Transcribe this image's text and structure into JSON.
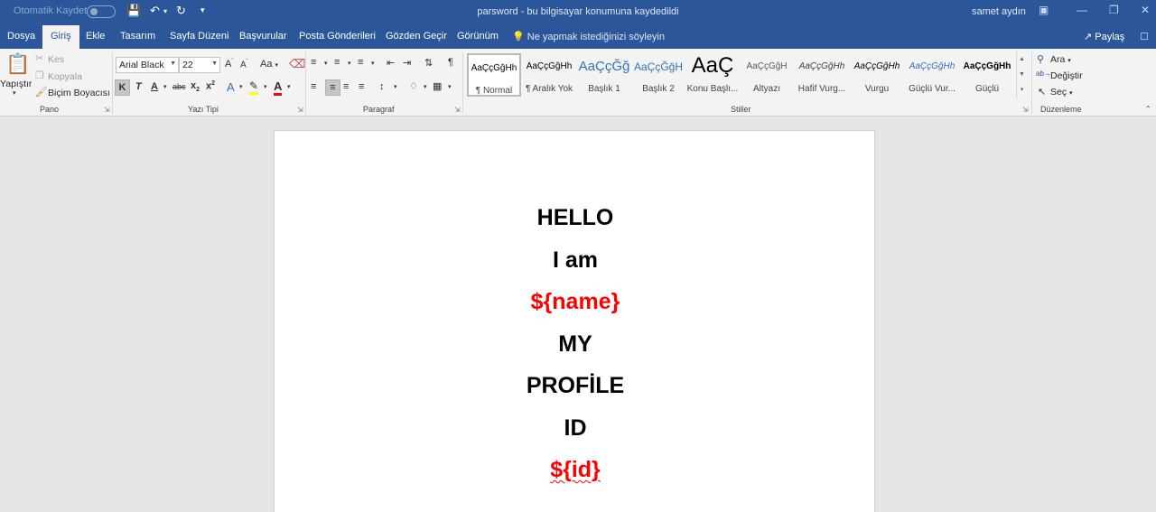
{
  "titlebar": {
    "autosave_label": "Otomatik Kaydet",
    "document_title": "parsword  -  bu bilgisayar konumuna kaydedildi",
    "user_name": "samet aydın"
  },
  "tabs": [
    {
      "label": "Dosya"
    },
    {
      "label": "Giriş"
    },
    {
      "label": "Ekle"
    },
    {
      "label": "Tasarım"
    },
    {
      "label": "Sayfa Düzeni"
    },
    {
      "label": "Başvurular"
    },
    {
      "label": "Posta Gönderileri"
    },
    {
      "label": "Gözden Geçir"
    },
    {
      "label": "Görünüm"
    }
  ],
  "tell_me": "Ne yapmak istediğinizi söyleyin",
  "share_label": "Paylaş",
  "clipboard": {
    "paste": "Yapıştır",
    "cut": "Kes",
    "copy": "Kopyala",
    "format_painter": "Biçim Boyacısı",
    "group": "Pano"
  },
  "font": {
    "family": "Arial Black",
    "size": "22",
    "grow": "A",
    "shrink": "A",
    "change_case": "Aa",
    "bold": "K",
    "italic": "T",
    "underline": "A",
    "strike": "abc",
    "subscript": "x",
    "superscript": "x",
    "text_effects": "A",
    "font_color": "A",
    "group": "Yazı Tipi"
  },
  "paragraph": {
    "group": "Paragraf"
  },
  "styles": {
    "group": "Stiller",
    "items": [
      {
        "sample": "AaÇçĞğHh",
        "name": "¶ Normal"
      },
      {
        "sample": "AaÇçĞğHh",
        "name": "¶ Aralık Yok"
      },
      {
        "sample": "AaÇçĞğ",
        "name": "Başlık 1"
      },
      {
        "sample": "AaÇçĞğH",
        "name": "Başlık 2"
      },
      {
        "sample": "AaÇ",
        "name": "Konu Başlı..."
      },
      {
        "sample": "AaÇçĞğH",
        "name": "Altyazı"
      },
      {
        "sample": "AaÇçĞğHh",
        "name": "Hafif Vurg..."
      },
      {
        "sample": "AaÇçĞğHh",
        "name": "Vurgu"
      },
      {
        "sample": "AaÇçĞğHh",
        "name": "Güçlü Vur..."
      },
      {
        "sample": "AaÇçĞğHh",
        "name": "Güçlü"
      }
    ]
  },
  "editing": {
    "find": "Ara",
    "replace": "Değiştir",
    "select": "Seç",
    "group": "Düzenleme"
  },
  "document": {
    "lines": [
      {
        "text": "HELLO"
      },
      {
        "text": "I am"
      },
      {
        "text": "${name}"
      },
      {
        "text": "MY"
      },
      {
        "text": "PROFİLE"
      },
      {
        "text": "ID"
      },
      {
        "text": "${id}"
      }
    ]
  },
  "colors": {
    "brand": "#2b579a",
    "ribbon": "#f3f3f3",
    "placeholder_red": "#ff0000"
  }
}
